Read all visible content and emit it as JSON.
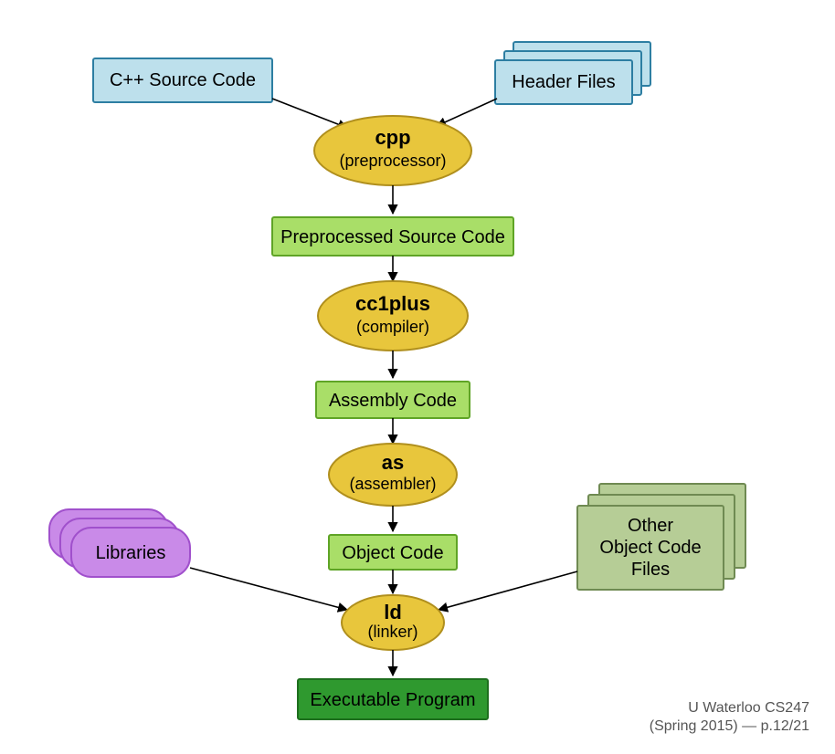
{
  "nodes": {
    "source": {
      "label": "C++ Source Code"
    },
    "headers": {
      "label": "Header Files"
    },
    "cpp": {
      "title": "cpp",
      "subtitle": "(preprocessor)"
    },
    "preprocessed": {
      "label": "Preprocessed Source Code"
    },
    "cc1plus": {
      "title": "cc1plus",
      "subtitle": "(compiler)"
    },
    "assembly": {
      "label": "Assembly Code"
    },
    "as": {
      "title": "as",
      "subtitle": "(assembler)"
    },
    "object": {
      "label": "Object Code"
    },
    "libraries": {
      "label": "Libraries"
    },
    "other_objects": {
      "line1": "Other",
      "line2": "Object Code",
      "line3": "Files"
    },
    "ld": {
      "title": "ld",
      "subtitle": "(linker)"
    },
    "executable": {
      "label": "Executable Program"
    }
  },
  "attribution": {
    "line1": "U Waterloo CS247",
    "line2": "(Spring 2015)  — p.12/21"
  },
  "colors": {
    "blue_fill": "#bde0ec",
    "blue_stroke": "#2d7ea2",
    "yellow_fill": "#e8c63c",
    "yellow_stroke": "#b08f1d",
    "lightgreen_fill": "#a9de68",
    "lightgreen_stroke": "#5fa426",
    "olive_fill": "#b6cd96",
    "olive_stroke": "#6f8a52",
    "purple_fill": "#c98ae8",
    "purple_stroke": "#a050cc",
    "darkgreen_fill": "#2f992f",
    "darkgreen_stroke": "#1e6f1e",
    "arrow": "#000000"
  }
}
